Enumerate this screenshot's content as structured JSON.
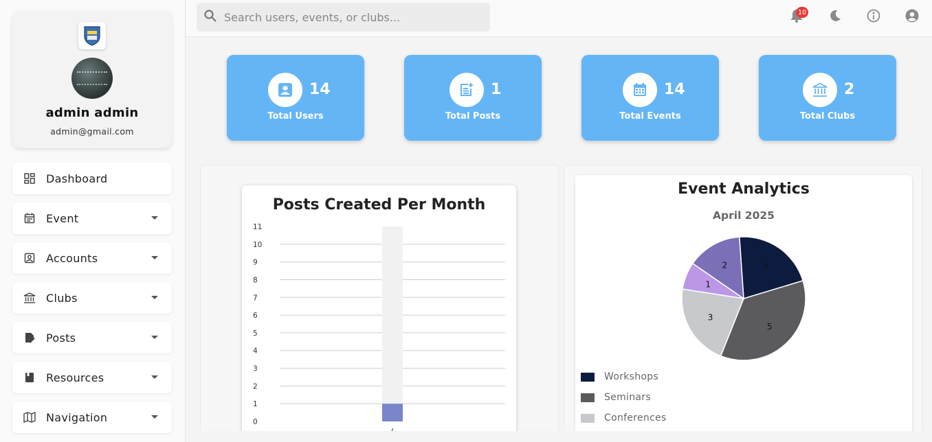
{
  "profile": {
    "name": "admin admin",
    "email": "admin@gmail.com"
  },
  "nav": [
    {
      "label": "Dashboard",
      "icon": "dashboard-icon",
      "has_caret": false
    },
    {
      "label": "Event",
      "icon": "event-icon",
      "has_caret": true
    },
    {
      "label": "Accounts",
      "icon": "accounts-icon",
      "has_caret": true
    },
    {
      "label": "Clubs",
      "icon": "clubs-icon",
      "has_caret": true
    },
    {
      "label": "Posts",
      "icon": "posts-icon",
      "has_caret": true
    },
    {
      "label": "Resources",
      "icon": "resources-icon",
      "has_caret": true
    },
    {
      "label": "Navigation",
      "icon": "navigation-icon",
      "has_caret": true
    }
  ],
  "topbar": {
    "search_placeholder": "Search users, events, or clubs...",
    "notification_count": "10"
  },
  "stats": [
    {
      "value": "14",
      "label": "Total Users",
      "icon": "users-icon"
    },
    {
      "value": "1",
      "label": "Total Posts",
      "icon": "posts-icon"
    },
    {
      "value": "14",
      "label": "Total Events",
      "icon": "calendar-icon"
    },
    {
      "value": "2",
      "label": "Total Clubs",
      "icon": "bank-icon"
    }
  ],
  "colors": {
    "accent": "#64b5f6",
    "bar": "#7986cb",
    "badge": "#e53935"
  },
  "chart_data": [
    {
      "type": "bar",
      "title": "Posts Created Per Month",
      "categories": [
        "("
      ],
      "values": [
        1
      ],
      "ylim": [
        0,
        11
      ],
      "yticks": [
        "0",
        "1",
        "2",
        "3",
        "4",
        "5",
        "6",
        "7",
        "8",
        "9",
        "10",
        "11"
      ],
      "grid": true
    },
    {
      "type": "pie",
      "title": "Event Analytics",
      "subtitle": "April 2025",
      "slices": [
        {
          "label": "Workshops",
          "value": 3,
          "color": "#0d1b3e"
        },
        {
          "label": "Seminars",
          "value": 5,
          "color": "#5b5b5e"
        },
        {
          "label": "Conferences",
          "value": 3,
          "color": "#c7c9cc"
        },
        {
          "label": "",
          "value": 1,
          "color": "#bb97e6"
        },
        {
          "label": "",
          "value": 2,
          "color": "#7b6fb8"
        }
      ],
      "legend_position": "bottom-left"
    }
  ]
}
